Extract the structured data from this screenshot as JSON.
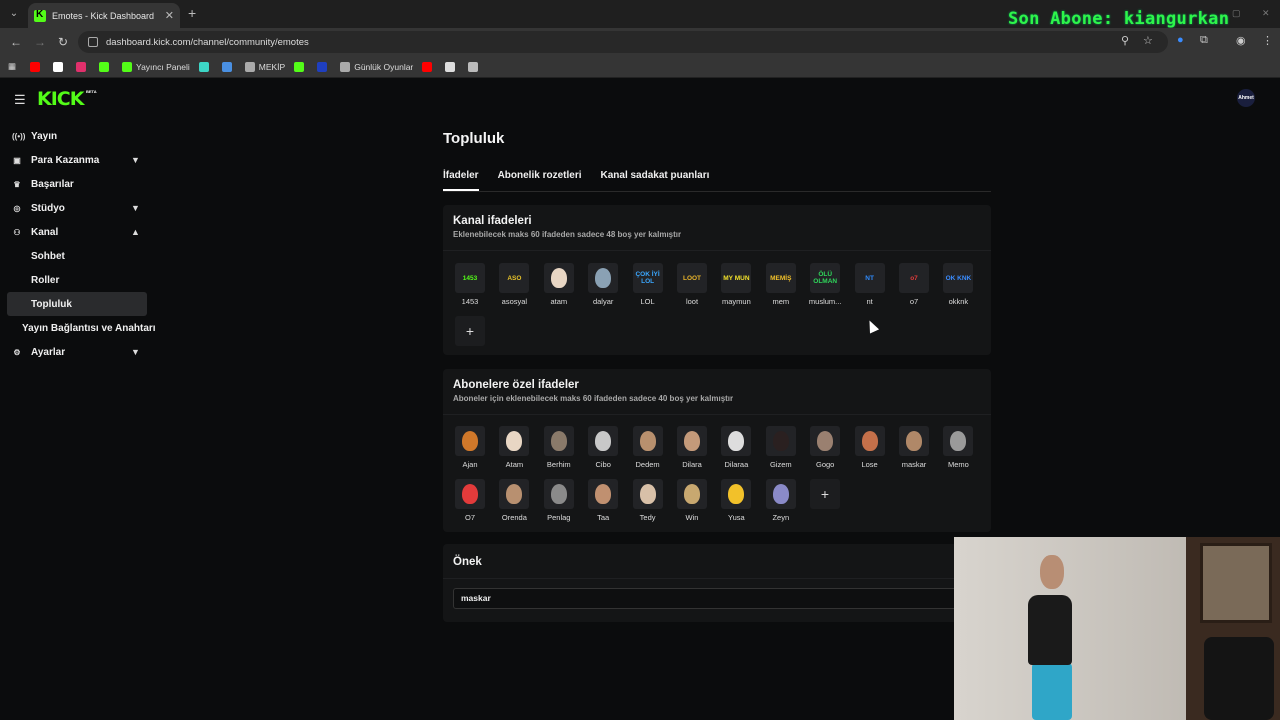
{
  "browser": {
    "tab_title": "Emotes - Kick Dashboard",
    "url": "dashboard.kick.com/channel/community/emotes",
    "bookmarks": [
      {
        "label": "",
        "color": "#ff0000"
      },
      {
        "label": "",
        "color": "#ffffff"
      },
      {
        "label": "",
        "color": "#e1306c"
      },
      {
        "label": "",
        "color": "#53fc18"
      },
      {
        "label": "Yayıncı Paneli",
        "color": "#53fc18"
      },
      {
        "label": "",
        "color": "#3dd6c6"
      },
      {
        "label": "",
        "color": "#4a90e2"
      },
      {
        "label": "MEKİP",
        "color": "#aaaaaa"
      },
      {
        "label": "",
        "color": "#53fc18"
      },
      {
        "label": "",
        "color": "#1f3fbf"
      },
      {
        "label": "Günlük Oyunlar",
        "color": "#aaaaaa"
      },
      {
        "label": "",
        "color": "#ff0000"
      },
      {
        "label": "",
        "color": "#dddddd"
      },
      {
        "label": "",
        "color": "#bbbbbb"
      }
    ]
  },
  "overlay": {
    "text": "Son Abone: kiangurkan",
    "color": "#2ef54a"
  },
  "kick": {
    "logo": "KICK",
    "beta": "BETA",
    "avatar_text": "Ahmet"
  },
  "sidebar": {
    "yayin": "Yayın",
    "para": "Para Kazanma",
    "basarilar": "Başarılar",
    "studyo": "Stüdyo",
    "kanal": "Kanal",
    "sohbet": "Sohbet",
    "roller": "Roller",
    "topluluk": "Topluluk",
    "baglanti": "Yayın Bağlantısı ve Anahtarı",
    "ayarlar": "Ayarlar"
  },
  "main": {
    "title": "Topluluk",
    "tabs": [
      "İfadeler",
      "Abonelik rozetleri",
      "Kanal sadakat puanları"
    ],
    "channel_emotes": {
      "title": "Kanal ifadeleri",
      "subtitle": "Eklenebilecek maks 60 ifadeden sadece 48 boş yer kalmıştır",
      "items": [
        {
          "label": "1453",
          "glyph": "1453",
          "color": "#53fc18"
        },
        {
          "label": "asosyal",
          "glyph": "ASO",
          "color": "#e8c32a"
        },
        {
          "label": "atam",
          "glyph": "",
          "color": "#e8d6c4"
        },
        {
          "label": "dalyar",
          "glyph": "",
          "color": "#8aa1b4"
        },
        {
          "label": "LOL",
          "glyph": "ÇOK İYİ LOL",
          "color": "#3aa7ff"
        },
        {
          "label": "loot",
          "glyph": "LOOT",
          "color": "#e8b32a"
        },
        {
          "label": "maymun",
          "glyph": "MY MUN",
          "color": "#f2e12a"
        },
        {
          "label": "mem",
          "glyph": "MEMİŞ",
          "color": "#f2c12a"
        },
        {
          "label": "muslum...",
          "glyph": "ÖLÜ OLMAN",
          "color": "#2fd65b"
        },
        {
          "label": "nt",
          "glyph": "NT",
          "color": "#2f8cff"
        },
        {
          "label": "o7",
          "glyph": "o7",
          "color": "#e33b3b"
        },
        {
          "label": "okknk",
          "glyph": "OK KNK",
          "color": "#3a8cff"
        }
      ]
    },
    "sub_emotes": {
      "title": "Abonelere özel ifadeler",
      "subtitle": "Aboneler için eklenebilecek maks 60 ifadeden sadece 40 boş yer kalmıştır",
      "items": [
        {
          "label": "Ajan",
          "color": "#d0782a"
        },
        {
          "label": "Atam",
          "color": "#e8d6c4"
        },
        {
          "label": "Berhim",
          "color": "#8a7a6a"
        },
        {
          "label": "Cibo",
          "color": "#c8c8c8"
        },
        {
          "label": "Dedem",
          "color": "#b8906e"
        },
        {
          "label": "Dilara",
          "color": "#c49a7a"
        },
        {
          "label": "Dilaraa",
          "color": "#dddddd"
        },
        {
          "label": "Gizem",
          "color": "#2a2020"
        },
        {
          "label": "Gogo",
          "color": "#9a8070"
        },
        {
          "label": "Lose",
          "color": "#c4704a"
        },
        {
          "label": "maskar",
          "color": "#b08868"
        },
        {
          "label": "Memo",
          "color": "#9a9a9a"
        },
        {
          "label": "O7",
          "color": "#e33b3b"
        },
        {
          "label": "Orenda",
          "color": "#b89070"
        },
        {
          "label": "Penlag",
          "color": "#8a8a8a"
        },
        {
          "label": "Taa",
          "color": "#c09070"
        },
        {
          "label": "Tedy",
          "color": "#d8c0a8"
        },
        {
          "label": "Win",
          "color": "#c8a870"
        },
        {
          "label": "Yusa",
          "color": "#f2c12a"
        },
        {
          "label": "Zeyn",
          "color": "#8a8ac8"
        }
      ]
    },
    "prefix": {
      "title": "Önek",
      "value": "maskar"
    }
  }
}
